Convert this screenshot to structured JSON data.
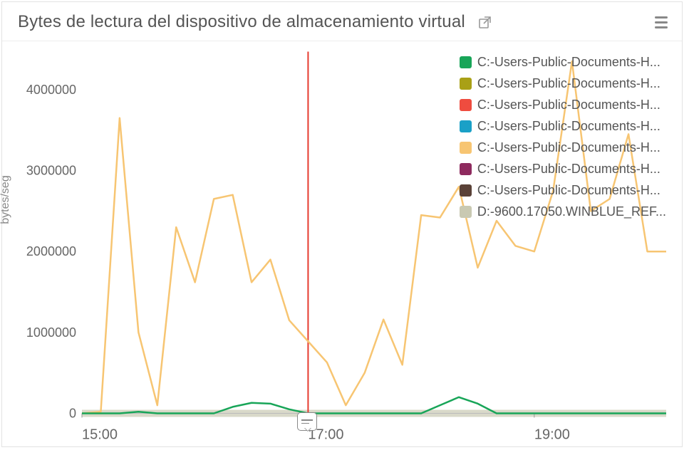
{
  "title": "Bytes de lectura del dispositivo de almacenamiento virtual",
  "ylabel": "bytes/seg",
  "legend": [
    {
      "label": "C:-Users-Public-Documents-H...",
      "color": "#18a558"
    },
    {
      "label": "C:-Users-Public-Documents-H...",
      "color": "#a9a016"
    },
    {
      "label": "C:-Users-Public-Documents-H...",
      "color": "#ef4c3f"
    },
    {
      "label": "C:-Users-Public-Documents-H...",
      "color": "#1aa0c7"
    },
    {
      "label": "C:-Users-Public-Documents-H...",
      "color": "#f7c572"
    },
    {
      "label": "C:-Users-Public-Documents-H...",
      "color": "#8e2a5e"
    },
    {
      "label": "C:-Users-Public-Documents-H...",
      "color": "#5a4137"
    },
    {
      "label": "D:-9600.17050.WINBLUE_REF...",
      "color": "#c9c9b2"
    }
  ],
  "yticks": [
    0,
    1000000,
    2000000,
    3000000,
    4000000
  ],
  "xticks": [
    "15:00",
    "17:00",
    "19:00"
  ],
  "chart_data": {
    "type": "line",
    "xlabel": "",
    "ylabel": "bytes/seg",
    "title": "Bytes de lectura del dispositivo de almacenamiento virtual",
    "ylim": [
      0,
      4400000
    ],
    "x_times_minutes": [
      900,
      910,
      920,
      930,
      940,
      950,
      960,
      970,
      980,
      990,
      1000,
      1010,
      1020,
      1030,
      1040,
      1050,
      1060,
      1070,
      1080,
      1090,
      1100,
      1110,
      1120,
      1130,
      1140,
      1150,
      1160,
      1170,
      1180,
      1190,
      1200,
      1210
    ],
    "series": [
      {
        "name": "orange",
        "color": "#f7c572",
        "values": [
          0,
          20000,
          3650000,
          1000000,
          100000,
          2300000,
          1620000,
          2650000,
          2700000,
          1620000,
          1900000,
          1150000,
          890000,
          630000,
          100000,
          500000,
          1160000,
          600000,
          2450000,
          2420000,
          2800000,
          1800000,
          2380000,
          2070000,
          2000000,
          2750000,
          4350000,
          2500000,
          2650000,
          3450000,
          2000000,
          2000000
        ]
      },
      {
        "name": "green",
        "color": "#18a558",
        "values": [
          0,
          0,
          0,
          20000,
          0,
          0,
          0,
          0,
          80000,
          130000,
          120000,
          50000,
          0,
          0,
          0,
          0,
          0,
          0,
          0,
          100000,
          200000,
          120000,
          0,
          0,
          0,
          0,
          0,
          0,
          0,
          0,
          0,
          0
        ]
      },
      {
        "name": "grey-base",
        "color": "#c9c9b2",
        "values": [
          0,
          0,
          0,
          0,
          0,
          0,
          0,
          0,
          0,
          0,
          0,
          0,
          0,
          0,
          0,
          0,
          0,
          0,
          0,
          0,
          0,
          0,
          0,
          0,
          0,
          0,
          0,
          0,
          0,
          0,
          0,
          0
        ]
      }
    ],
    "marker": {
      "x_minutes": 1020,
      "color": "#e63b2e"
    },
    "xtick_minutes": [
      900,
      1020,
      1140
    ]
  }
}
